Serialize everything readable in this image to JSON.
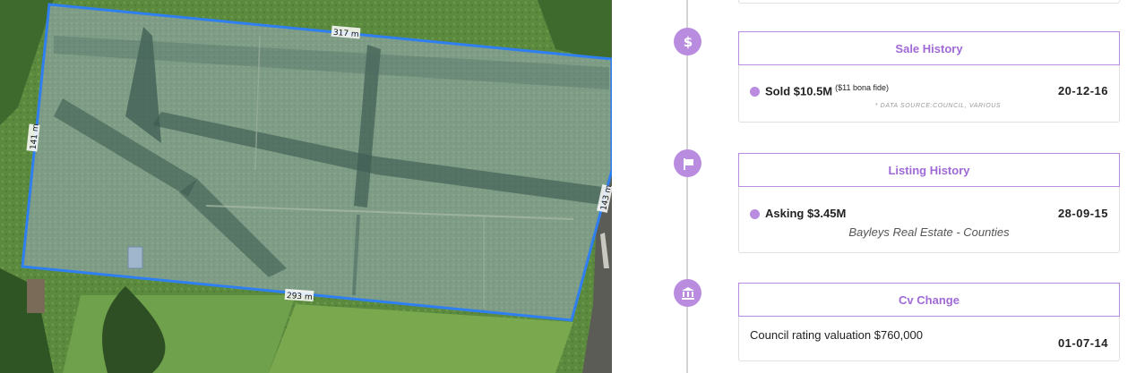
{
  "map": {
    "measurements": {
      "top": "317 m",
      "left": "141 m",
      "right": "143 m",
      "bottom": "293 m"
    }
  },
  "timeline": {
    "line_color": "#d4d4d4",
    "accent": "#b98ce0",
    "events": [
      {
        "icon": "dollar-icon",
        "title": "Sale History",
        "label": "Sold $10.5M",
        "note": "($11 bona fide)",
        "date": "20-12-16",
        "source": "* DATA SOURCE:COUNCIL, VARIOUS"
      },
      {
        "icon": "flag-icon",
        "title": "Listing History",
        "label": "Asking $3.45M",
        "date": "28-09-15",
        "agent": "Bayleys Real Estate - Counties"
      },
      {
        "icon": "bank-icon",
        "title": "Cv Change",
        "label": "Council rating valuation $760,000",
        "date": "01-07-14"
      }
    ]
  }
}
